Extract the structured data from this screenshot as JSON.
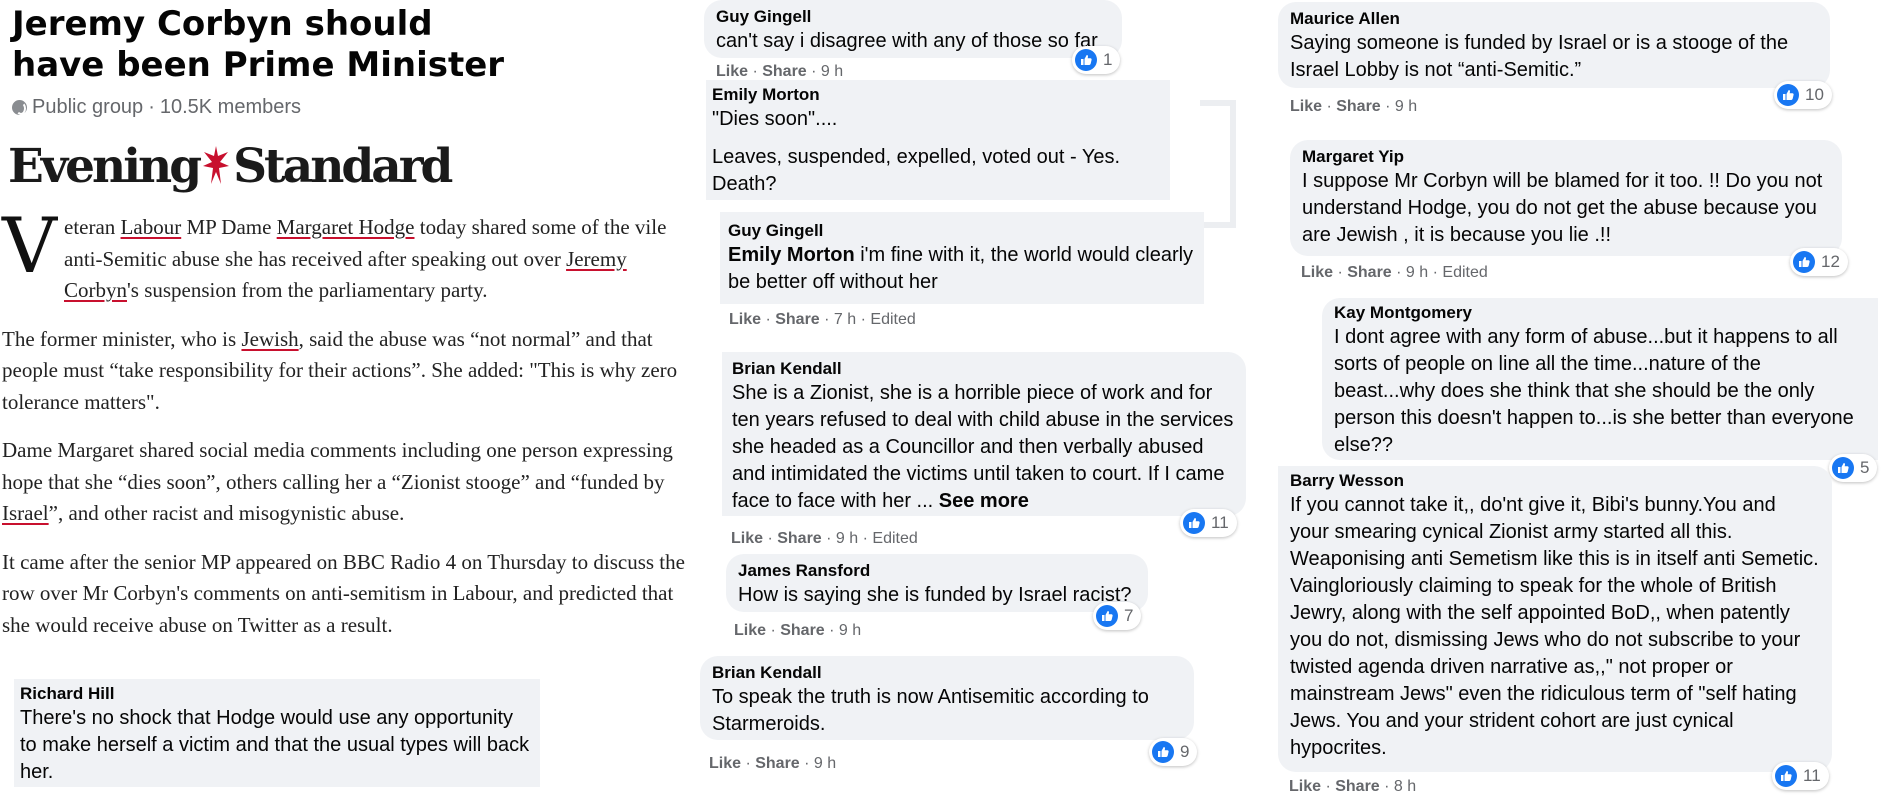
{
  "group": {
    "title": "Jeremy Corbyn should have been Prime Minister",
    "privacy": "Public group",
    "members": "10.5K members"
  },
  "article": {
    "publication": {
      "left": "Evening",
      "right": "Standard"
    },
    "dropcap": "V",
    "p1": {
      "t1": "eteran ",
      "l1": "Labour",
      "t2": " MP Dame ",
      "l2": "Margaret Hodge",
      "t3": " today shared some of the vile anti-Semitic abuse she has received after speaking out over ",
      "l3": "Jeremy Corbyn",
      "t4": "'s suspension from the parliamentary party."
    },
    "p2": {
      "t1": "The former minister, who is ",
      "l1": "Jewish",
      "t2": ", said the abuse was “not normal” and that people must “take responsibility for their actions”. She added: \"This is why zero tolerance matters\"."
    },
    "p3": {
      "t1": "Dame Margaret shared social media comments including one person expressing hope that she “dies soon”, others calling her a “Zionist stooge” and “funded by ",
      "l1": "Israel",
      "t2": "”, and other racist and misogynistic abuse."
    },
    "p4": "It came after the senior MP appeared on BBC Radio 4 on Thursday to discuss the row over Mr Corbyn's comments on anti-semitism in Labour, and predicted that she would receive abuse on Twitter as a result."
  },
  "actions": {
    "like": "Like",
    "share": "Share",
    "sep": " · "
  },
  "comments": [
    {
      "id": "richard",
      "author": "Richard Hill",
      "text": "There's no shock that Hodge would use any opportunity to make herself a victim and that the usual types will back her."
    },
    {
      "id": "guy1",
      "author": "Guy Gingell",
      "text": "can't say i disagree with any of those so far",
      "time": "9 h",
      "likes": "1"
    },
    {
      "id": "emily",
      "author": "Emily Morton",
      "text1": "\"Dies soon\"....",
      "text2": "Leaves, suspended, expelled, voted out - Yes. Death?"
    },
    {
      "id": "guy2",
      "author": "Guy Gingell",
      "mention": "Emily Morton",
      "text": " i'm fine with it, the world would clearly be better off without her",
      "time": "7 h",
      "edited": "Edited"
    },
    {
      "id": "brian1",
      "author": "Brian Kendall",
      "text": "She is a Zionist, she is a horrible piece of work and for ten years refused to deal with child abuse in the services she headed as a Councillor and then verbally abused and intimidated the victims until taken to court. If I came face to face with her ... ",
      "see_more": "See more",
      "time": "9 h",
      "edited": "Edited",
      "likes": "11"
    },
    {
      "id": "james",
      "author": "James Ransford",
      "text": "How is saying she is funded by Israel racist?",
      "time": "9 h",
      "likes": "7"
    },
    {
      "id": "brian2",
      "author": "Brian Kendall",
      "text": "To speak the truth is now Antisemitic according to Starmeroids.",
      "time": "9 h",
      "likes": "9"
    },
    {
      "id": "maurice",
      "author": "Maurice Allen",
      "text": "Saying someone is funded by Israel or is a stooge of the Israel Lobby is not “anti-Semitic.”",
      "time": "9 h",
      "likes": "10"
    },
    {
      "id": "margaret",
      "author": "Margaret Yip",
      "text": "I suppose Mr Corbyn will be blamed for it too. !! Do you not understand Hodge, you do not get the abuse because you are Jewish , it is because you lie .!!",
      "time": "9 h",
      "edited": "Edited",
      "likes": "12"
    },
    {
      "id": "kay",
      "author": "Kay Montgomery",
      "text": "I dont agree with any form of abuse...but it happens to all sorts of people on line all the time...nature of the beast...why does she think that she should be the only person this doesn't happen to...is she better than everyone else??",
      "likes": "5"
    },
    {
      "id": "barry",
      "author": "Barry Wesson",
      "text": "If you cannot take it,, do'nt give it, Bibi's bunny.You and your smearing cynical Zionist army started all this. Weaponising anti Semetism like this is in itself anti Semetic. Vaingloriously claiming to speak for the whole of British Jewry, along with the self appointed BoD,, when patently you do not, dismissing Jews who do not subscribe to your twisted agenda driven narrative as,,\" not proper or mainstream Jews\" even the ridiculous term of \"self hating Jews. You and your strident cohort are just cynical hypocrites.",
      "time": "8 h",
      "likes": "11"
    }
  ],
  "colors": {
    "bubble": "#f0f2f5",
    "like_blue": "#1877f2",
    "muted": "#65676b",
    "link_underline": "#c8102e"
  },
  "icons": {
    "like": "thumbs-up-icon",
    "privacy": "globe-icon",
    "logo_emblem": "eagle-emblem"
  }
}
